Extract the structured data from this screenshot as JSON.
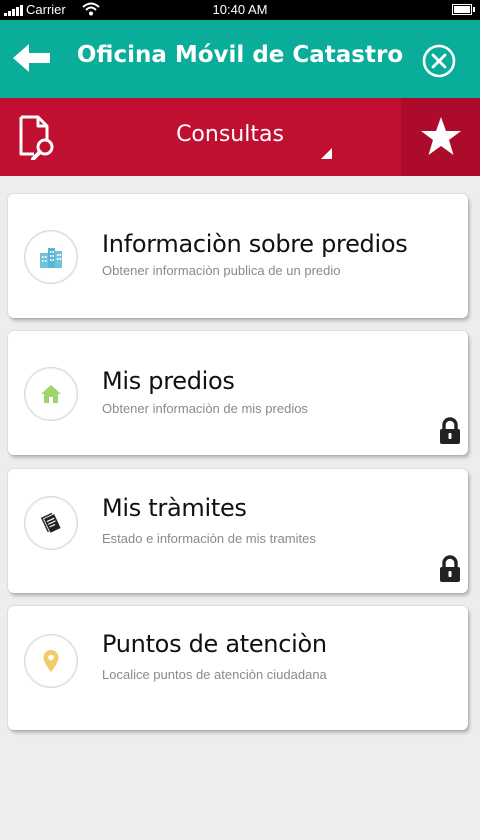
{
  "status_bar": {
    "carrier": "Carrier",
    "time": "10:40 AM"
  },
  "header": {
    "title": "Oficina Móvil de Catastro",
    "back_icon": "arrow-left-icon",
    "close_icon": "close-circle-icon"
  },
  "subheader": {
    "title": "Consultas",
    "colors": {
      "bar": "#c10f32",
      "fav": "#ad0b2c"
    }
  },
  "colors": {
    "header": "#09ad99",
    "background": "#ededed"
  },
  "menu": [
    {
      "title": "Informaciòn sobre predios",
      "description": "Obtener informaciòn publica de un predio",
      "icon": "buildings-icon",
      "locked": false
    },
    {
      "title": "Mis predios",
      "description": "Obtener informaciòn de mis predios",
      "icon": "home-icon",
      "locked": true
    },
    {
      "title": "Mis tràmites",
      "description": "Estado e informaciòn de mis tramites",
      "icon": "documents-icon",
      "locked": true
    },
    {
      "title": "Puntos de atenciòn",
      "description": "Localice puntos de atenciòn ciudadana",
      "icon": "map-pin-icon",
      "locked": false
    }
  ]
}
